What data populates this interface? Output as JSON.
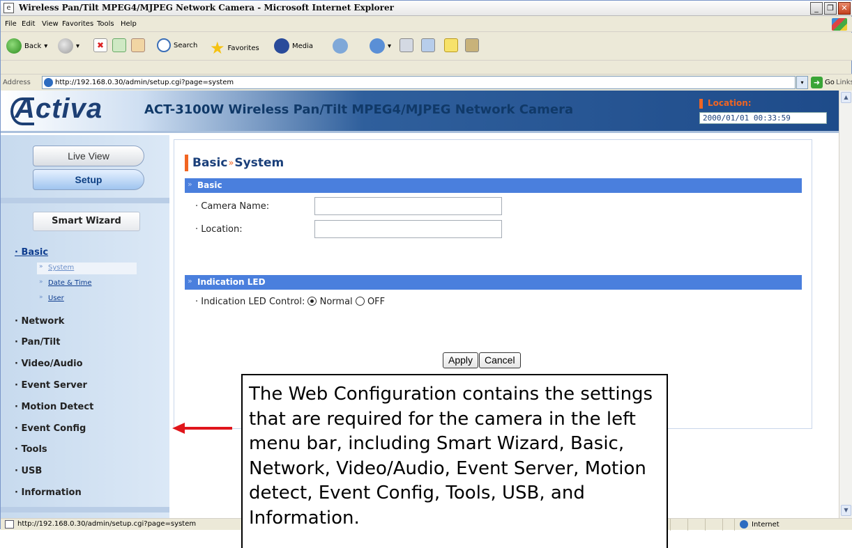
{
  "browser": {
    "window_title": "Wireless Pan/Tilt MPEG4/MJPEG Network Camera - Microsoft Internet Explorer",
    "menus": [
      "File",
      "Edit",
      "View",
      "Favorites",
      "Tools",
      "Help"
    ],
    "toolbar": {
      "back": "Back",
      "search": "Search",
      "favorites": "Favorites",
      "media": "Media"
    },
    "address_label": "Address",
    "address_value": "http://192.168.0.30/admin/setup.cgi?page=system",
    "go_label": "Go",
    "links_label": "Links",
    "status_text": "http://192.168.0.30/admin/setup.cgi?page=system",
    "zone_label": "Internet"
  },
  "header": {
    "logo": "Activa",
    "product_title": "ACT-3100W Wireless Pan/Tilt MPEG4/MJPEG Network Camera",
    "location_label": "Location:",
    "datetime": "2000/01/01 00:33:59"
  },
  "sidebar": {
    "live_view": "Live View",
    "setup": "Setup",
    "smart_wizard": "Smart Wizard",
    "basic": "Basic",
    "sub_items": [
      {
        "label": "System"
      },
      {
        "label": "Date & Time"
      },
      {
        "label": "User"
      }
    ],
    "items": [
      {
        "label": "Network"
      },
      {
        "label": "Pan/Tilt"
      },
      {
        "label": "Video/Audio"
      },
      {
        "label": "Event Server"
      },
      {
        "label": "Motion Detect"
      },
      {
        "label": "Event Config"
      },
      {
        "label": "Tools"
      },
      {
        "label": "USB"
      },
      {
        "label": "Information"
      }
    ]
  },
  "content": {
    "title_main": "Basic",
    "title_sep": "»",
    "title_sub": "System",
    "section_basic": "Basic",
    "camera_name_label": "Camera Name:",
    "camera_name_value": "",
    "location_label": "Location:",
    "location_value": "",
    "section_led": "Indication LED",
    "led_control_label": "Indication LED Control:",
    "led_options": [
      "Normal",
      "OFF"
    ],
    "led_selected": "Normal",
    "apply": "Apply",
    "cancel": "Cancel"
  },
  "callout": {
    "text_parts": [
      "The Web Configuration contains the settings that are required for the camera in the left menu bar, including ",
      "Smart Wizard",
      ", ",
      "Basic",
      ", ",
      "Network",
      ", ",
      "Video/Audio",
      ", ",
      "Event Server",
      ", ",
      "Motion detect",
      ", ",
      "Event Config",
      ", ",
      "Tools",
      ", ",
      "USB",
      ", and ",
      "Information",
      "."
    ]
  },
  "colors": {
    "accent": "#f26522",
    "section_bar": "#4a7fdd",
    "header_blue": "#1e4b8a",
    "sidebar_bg": "#c7daee",
    "arrow": "#e0161b"
  }
}
